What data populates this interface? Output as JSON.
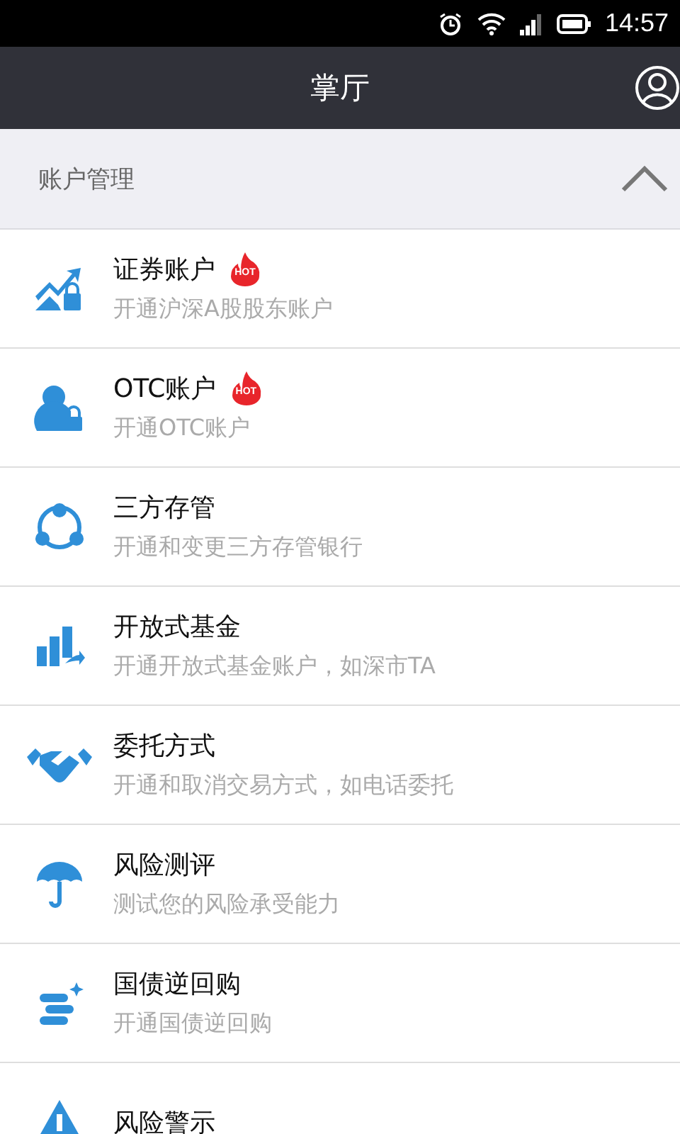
{
  "status_bar": {
    "time": "14:57"
  },
  "header": {
    "title": "掌厅"
  },
  "section": {
    "title": "账户管理",
    "expanded": true
  },
  "items": [
    {
      "title": "证券账户",
      "subtitle": "开通沪深A股股东账户",
      "badge": "HOT"
    },
    {
      "title": "OTC账户",
      "subtitle": "开通OTC账户",
      "badge": "HOT"
    },
    {
      "title": "三方存管",
      "subtitle": "开通和变更三方存管银行"
    },
    {
      "title": "开放式基金",
      "subtitle": "开通开放式基金账户，如深市TA"
    },
    {
      "title": "委托方式",
      "subtitle": "开通和取消交易方式，如电话委托"
    },
    {
      "title": "风险测评",
      "subtitle": "测试您的风险承受能力"
    },
    {
      "title": "国债逆回购",
      "subtitle": "开通国债逆回购"
    },
    {
      "title": "风险警示"
    }
  ]
}
